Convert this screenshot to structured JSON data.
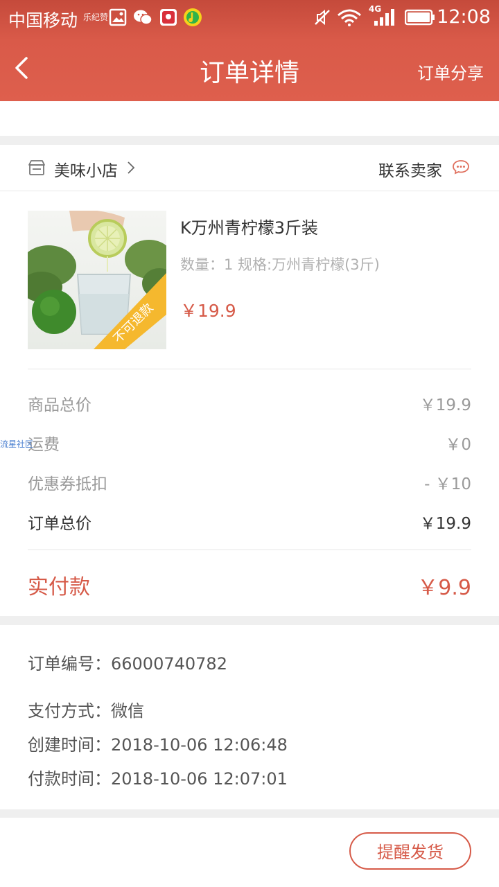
{
  "status_bar": {
    "carrier": "中国移动",
    "carrier_extra": "乐纪赞",
    "network": "4G",
    "time": "12:08",
    "icons": [
      "image-icon",
      "wechat-icon",
      "app-icon",
      "music-icon",
      "mute-icon",
      "wifi-icon",
      "signal-icon",
      "battery-icon"
    ]
  },
  "nav": {
    "back_icon": "chevron-left-icon",
    "title": "订单详情",
    "share": "订单分享"
  },
  "shop": {
    "icon": "shop-icon",
    "name": "美味小店",
    "contact": "联系卖家",
    "contact_icon": "chat-icon"
  },
  "product": {
    "name": "K万州青柠檬3斤装",
    "spec": "数量：1 规格:万州青柠檬(3斤)",
    "price": "￥19.9",
    "badge": "不可退款"
  },
  "summary": [
    {
      "label": "商品总价",
      "value": "￥19.9"
    },
    {
      "label": "运费",
      "value": "￥0"
    },
    {
      "label": "优惠券抵扣",
      "value": "- ￥10"
    },
    {
      "label": "订单总价",
      "value": "￥19.9"
    }
  ],
  "paid": {
    "label": "实付款",
    "value": "￥9.9"
  },
  "order_info": [
    {
      "label": "订单编号：",
      "value": "66000740782"
    },
    {
      "label": "支付方式：",
      "value": "微信"
    },
    {
      "label": "创建时间：",
      "value": "2018-10-06 12:06:48"
    },
    {
      "label": "付款时间：",
      "value": "2018-10-06 12:07:01"
    }
  ],
  "actions": {
    "remind": "提醒发货"
  },
  "watermark": "流星社区",
  "colors": {
    "accent": "#d65a48",
    "header": "#de5f4d",
    "badge": "#f5b82e"
  }
}
